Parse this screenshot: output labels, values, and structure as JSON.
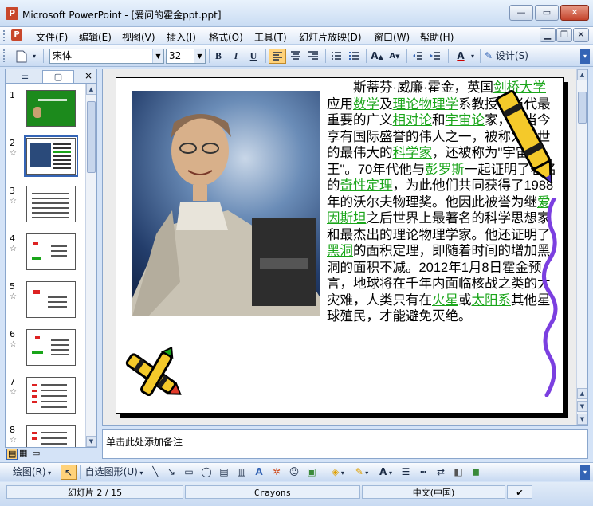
{
  "window": {
    "title": "Microsoft PowerPoint - [爱问的霍金ppt.ppt]",
    "app_icon_label": "P",
    "minimize": "—",
    "maximize": "▭",
    "close": "✕",
    "doc_minimize": "▁",
    "doc_restore": "❐",
    "doc_close": "✕"
  },
  "menu": {
    "items": [
      "文件(F)",
      "编辑(E)",
      "视图(V)",
      "插入(I)",
      "格式(O)",
      "工具(T)",
      "幻灯片放映(D)",
      "窗口(W)",
      "帮助(H)"
    ]
  },
  "toolbar": {
    "font_name": "宋体",
    "font_size": "32",
    "bold": "B",
    "italic": "I",
    "underline": "U",
    "design_label": "设计(S)"
  },
  "left_panel": {
    "tab_outline": "☰",
    "tab_slides": "▢",
    "close": "×",
    "thumbnails": [
      {
        "num": "1",
        "star": ""
      },
      {
        "num": "2",
        "star": "☆"
      },
      {
        "num": "3",
        "star": "☆"
      },
      {
        "num": "4",
        "star": "☆"
      },
      {
        "num": "5",
        "star": "☆"
      },
      {
        "num": "6",
        "star": "☆"
      },
      {
        "num": "7",
        "star": "☆"
      },
      {
        "num": "8",
        "star": "☆"
      }
    ]
  },
  "slide": {
    "paragraph": [
      {
        "t": "　　斯蒂芬·威廉·霍金，英国",
        "link": false
      },
      {
        "t": "剑桥大学",
        "link": true
      },
      {
        "t": "应用",
        "link": false
      },
      {
        "t": "数学",
        "link": true
      },
      {
        "t": "及",
        "link": false
      },
      {
        "t": "理论物理学",
        "link": true
      },
      {
        "t": "系教授，当代最重要的广义",
        "link": false
      },
      {
        "t": "相对论",
        "link": true
      },
      {
        "t": "和",
        "link": false
      },
      {
        "t": "宇宙论",
        "link": true
      },
      {
        "t": "家，是当今享有国际盛誉的伟人之一，被称为在世的最伟大的",
        "link": false
      },
      {
        "t": "科学家",
        "link": true
      },
      {
        "t": "，还被称为\"宇宙之王\"。70年代他与",
        "link": false
      },
      {
        "t": "彭罗斯",
        "link": true
      },
      {
        "t": "一起证明了著名的",
        "link": false
      },
      {
        "t": "奇性定理",
        "link": true
      },
      {
        "t": "，为此他们共同获得了1988年的沃尔夫物理奖。他因此被誉为继",
        "link": false
      },
      {
        "t": "爱因斯坦",
        "link": true
      },
      {
        "t": "之后世界上最著名的科学思想家和最杰出的理论物理学家。他还证明了",
        "link": false
      },
      {
        "t": "黑洞",
        "link": true
      },
      {
        "t": "的面积定理，即随着时间的增加黑洞的面积不减。2012年1月8日霍金预言，地球将在千年内面临核战之类的大灾难，人类只有在",
        "link": false
      },
      {
        "t": "火星",
        "link": true
      },
      {
        "t": "或",
        "link": false
      },
      {
        "t": "太阳系",
        "link": true
      },
      {
        "t": "其他星球殖民，才能避免灭绝。",
        "link": false
      }
    ]
  },
  "notes": {
    "placeholder": "单击此处添加备注"
  },
  "drawbar": {
    "draw_label": "绘图(R)",
    "autoshape_label": "自选图形(U)"
  },
  "status": {
    "slide_info": "幻灯片 2 / 15",
    "design": "Crayons",
    "language": "中文(中国)"
  },
  "colors": {
    "link_green": "#1aa51a",
    "accent_blue": "#3464b5"
  }
}
